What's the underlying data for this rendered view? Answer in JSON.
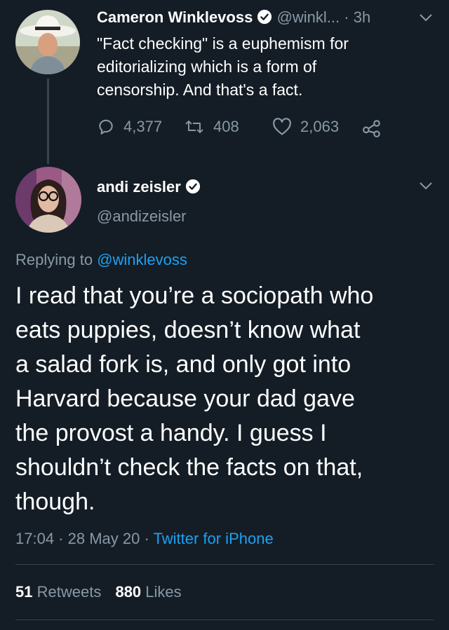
{
  "tweet1": {
    "name": "Cameron Winklevoss",
    "handle": "@winkl...",
    "sep": "·",
    "time": "3h",
    "text_lines": [
      "\"Fact checking\" is a euphemism for",
      "editorializing which is a form of",
      "censorship. And that's a fact."
    ],
    "replies": "4,377",
    "retweets": "408",
    "likes": "2,063"
  },
  "tweet2": {
    "name": "andi zeisler",
    "handle": "@andizeisler",
    "replying_prefix": "Replying to",
    "replying_to": "@winklevoss",
    "text_lines": [
      "I read that you’re a sociopath who",
      "eats puppies, doesn’t know what",
      "a salad fork is, and only got into",
      "Harvard because your dad gave",
      "the provost a handy. I guess I",
      "shouldn’t check the facts on that,",
      "though."
    ],
    "timestamp": "17:04 · 28 May 20 ·",
    "source": "Twitter for iPhone",
    "retweet_count": "51",
    "retweet_label": "Retweets",
    "like_count": "880",
    "like_label": "Likes"
  },
  "colors": {
    "background": "#141d26",
    "muted": "#8899a6",
    "accent": "#1da1f2",
    "divider": "#38444d"
  }
}
